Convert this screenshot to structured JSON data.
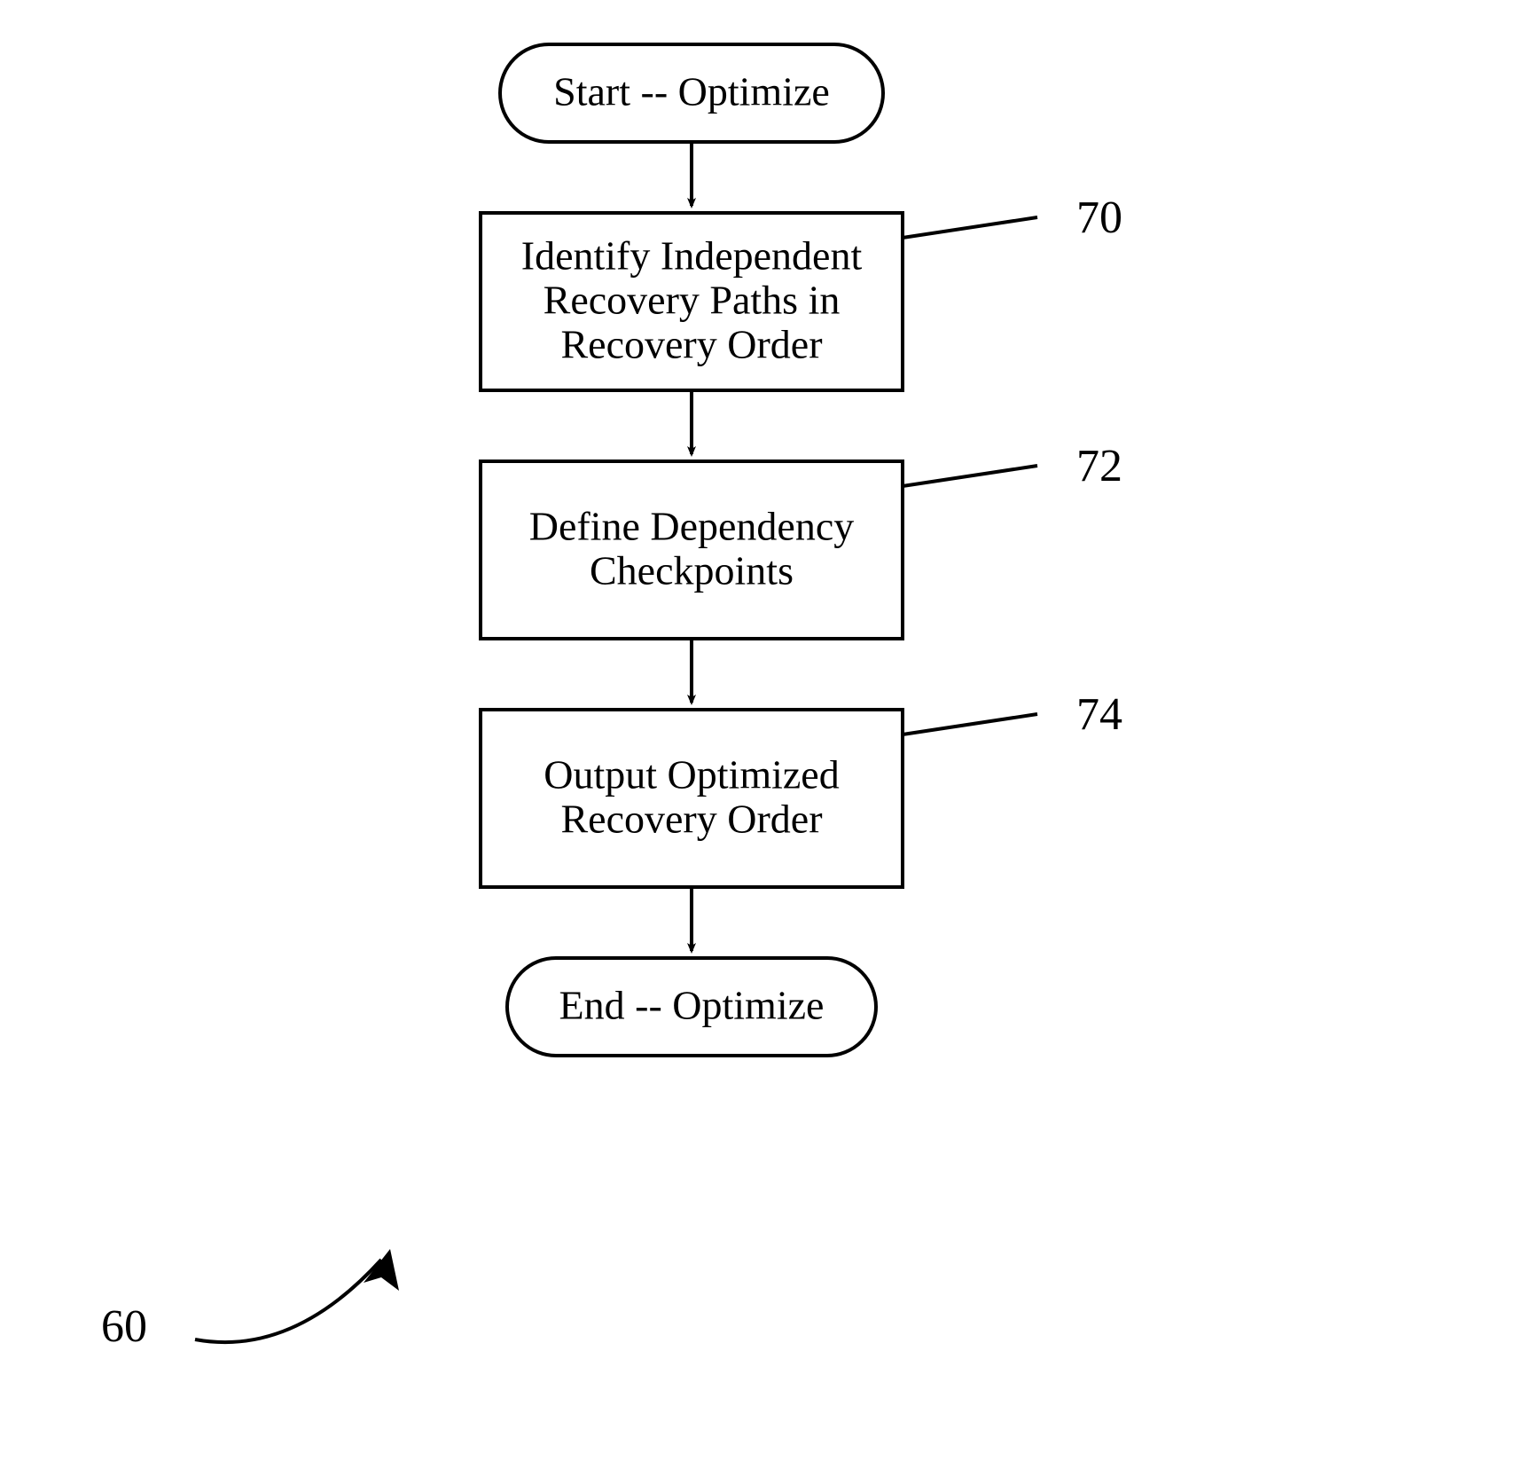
{
  "nodes": {
    "start": {
      "label": "Start -- Optimize"
    },
    "step1": {
      "line1": "Identify Independent",
      "line2": "Recovery Paths in",
      "line3": "Recovery Order",
      "ref": "70"
    },
    "step2": {
      "line1": "Define Dependency",
      "line2": "Checkpoints",
      "ref": "72"
    },
    "step3": {
      "line1": "Output Optimized",
      "line2": "Recovery Order",
      "ref": "74"
    },
    "end": {
      "label": "End -- Optimize"
    }
  },
  "figure_ref": "60"
}
